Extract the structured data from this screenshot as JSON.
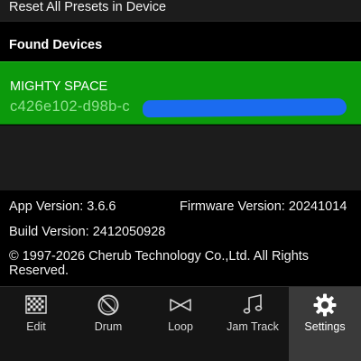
{
  "settings_list": {
    "reset_presets_label": "Reset All Presets in Device",
    "found_devices_header": "Found Devices"
  },
  "device": {
    "name": "MIGHTY SPACE",
    "id_visible": "c426e102-d98b-c"
  },
  "info": {
    "app_version": "App Version: 3.6.6",
    "firmware_version": "Firmware Version: 20241014",
    "build_version": "Build Version: 2412050928",
    "copyright_line1": "© 1997-2026 Cherub Technology Co.,Ltd. All Rights",
    "copyright_line2": "Reserved."
  },
  "tabs": [
    {
      "label": "Edit",
      "icon": "edit-grid-icon",
      "active": false
    },
    {
      "label": "Drum",
      "icon": "drum-icon",
      "active": false
    },
    {
      "label": "Loop",
      "icon": "loop-icon",
      "active": false
    },
    {
      "label": "Jam Track",
      "icon": "music-note-icon",
      "active": false
    },
    {
      "label": "Settings",
      "icon": "gear-icon",
      "active": true
    }
  ],
  "colors": {
    "device_green": "#0c9a0c",
    "redaction_blue": "#1b6bf0",
    "active_tab": "#3a3a3a"
  }
}
